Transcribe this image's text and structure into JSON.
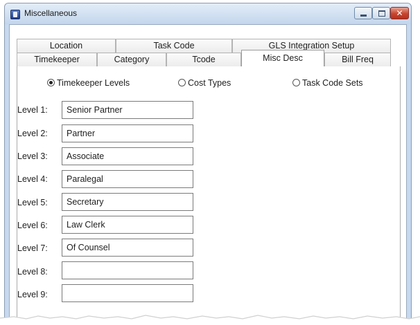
{
  "window": {
    "title": "Miscellaneous",
    "close_glyph": "✕"
  },
  "tabs_row1": [
    "Location",
    "Task Code",
    "GLS Integration Setup"
  ],
  "tabs_row2": [
    "Timekeeper",
    "Category",
    "Tcode",
    "Misc Desc",
    "Bill Freq"
  ],
  "active_tab": "Misc Desc",
  "radios": [
    {
      "label": "Timekeeper Levels",
      "checked": true
    },
    {
      "label": "Cost Types",
      "checked": false
    },
    {
      "label": "Task Code Sets",
      "checked": false
    }
  ],
  "levels": [
    {
      "label": "Level 1:",
      "value": "Senior Partner"
    },
    {
      "label": "Level 2:",
      "value": "Partner"
    },
    {
      "label": "Level 3:",
      "value": "Associate"
    },
    {
      "label": "Level 4:",
      "value": "Paralegal"
    },
    {
      "label": "Level 5:",
      "value": "Secretary"
    },
    {
      "label": "Level 6:",
      "value": "Law Clerk"
    },
    {
      "label": "Level 7:",
      "value": "Of Counsel"
    },
    {
      "label": "Level 8:",
      "value": ""
    },
    {
      "label": "Level 9:",
      "value": ""
    }
  ],
  "colors": {
    "title_bar": "#c7d9ee",
    "close_button": "#c9452f"
  }
}
